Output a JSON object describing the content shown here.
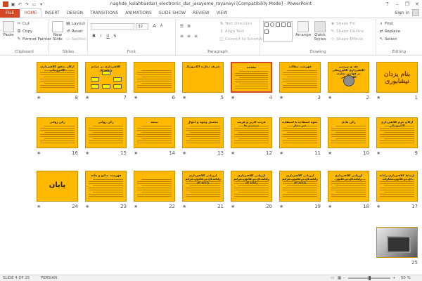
{
  "window": {
    "title": "naghde_kolahbardari_electronic_dar_jarayeme_rayaneyi [Compatibility Mode] - PowerPoint",
    "help": "?",
    "minimize": "–",
    "restore": "❐",
    "close": "✕"
  },
  "qat": {
    "save": "▣",
    "undo": "↶",
    "redo": "↷",
    "start": "▭",
    "more": "▾"
  },
  "tabs": [
    {
      "label": "FILE"
    },
    {
      "label": "HOME"
    },
    {
      "label": "INSERT"
    },
    {
      "label": "DESIGN"
    },
    {
      "label": "TRANSITIONS"
    },
    {
      "label": "ANIMATIONS"
    },
    {
      "label": "SLIDE SHOW"
    },
    {
      "label": "REVIEW"
    },
    {
      "label": "VIEW"
    }
  ],
  "account": {
    "signin": "Sign in"
  },
  "ribbon": {
    "clipboard": {
      "label": "Clipboard",
      "paste": "Paste",
      "cut": "Cut",
      "copy": "Copy",
      "format_painter": "Format Painter"
    },
    "slides": {
      "label": "Slides",
      "new_slide": "New Slide",
      "layout": "Layout",
      "reset": "Reset",
      "section": "Section"
    },
    "font": {
      "label": "Font",
      "font_size": "32",
      "bold": "B",
      "italic": "I",
      "underline": "U",
      "strike": "S",
      "grow": "A",
      "shrink": "A"
    },
    "paragraph": {
      "label": "Paragraph",
      "text_direction": "Text Direction",
      "align_text": "Align Text",
      "convert_smartart": "Convert to SmartArt"
    },
    "drawing": {
      "label": "Drawing",
      "arrange": "Arrange",
      "quick_styles": "Quick Styles",
      "shape_fill": "Shape Fill",
      "shape_outline": "Shape Outline",
      "shape_effects": "Shape Effects"
    },
    "editing": {
      "label": "Editing",
      "find": "Find",
      "replace": "Replace",
      "select": "Select"
    }
  },
  "slides": [
    {
      "num": "1",
      "title": "",
      "fancy": "بنام یزدان نیشابوری",
      "kind": "fancy"
    },
    {
      "num": "2",
      "title": "نقد و بررسی کلاهبرداری الکترونیکی در قوانین تجارت الکترونیکی",
      "kind": "emblem"
    },
    {
      "num": "3",
      "title": "فهرست مطالب",
      "kind": "text"
    },
    {
      "num": "4",
      "title": "مقدمه",
      "kind": "text"
    },
    {
      "num": "5",
      "title": "تعریف تجارت الکترونیک",
      "kind": "title"
    },
    {
      "num": "6",
      "title": "",
      "kind": "text"
    },
    {
      "num": "7",
      "title": "کلاهبرداری در جرایم رایانه ای",
      "kind": "boxes"
    },
    {
      "num": "8",
      "title": "ارکان تحقق کلاهبرداری الکترونیکی",
      "kind": "text"
    },
    {
      "num": "9",
      "title": "ارکان جرم کلاهبرداری الکترونیکی",
      "kind": "text"
    },
    {
      "num": "10",
      "title": "رکن مادی",
      "kind": "text"
    },
    {
      "num": "11",
      "title": "نحوه استفاده با استفاده غیر مجاز",
      "kind": "text"
    },
    {
      "num": "12",
      "title": "فریب کاربر و فریب سیستم ها",
      "kind": "text"
    },
    {
      "num": "13",
      "title": "تحصیل وجوه و اموال",
      "kind": "text"
    },
    {
      "num": "14",
      "title": "نتیجه",
      "kind": "text"
    },
    {
      "num": "15",
      "title": "رکن روانی",
      "kind": "text"
    },
    {
      "num": "16",
      "title": "رکن روانی",
      "kind": "text"
    },
    {
      "num": "17",
      "title": "ارتباط کلاهبرداری رایانه ای در قانون مجازات",
      "kind": "text"
    },
    {
      "num": "18",
      "title": "ارزیابی کلاهبرداری رایانه ای در قانون",
      "kind": "text"
    },
    {
      "num": "19",
      "title": "ارزیابی کلاهبرداری رایانه ای در قانون جرایم رایانه ای",
      "kind": "text"
    },
    {
      "num": "20",
      "title": "ارزیابی کلاهبرداری رایانه ای در قانون جرایم رایانه ای",
      "kind": "text"
    },
    {
      "num": "21",
      "title": "ارزیابی کلاهبرداری رایانه ای در قانون جرایم رایانه ای",
      "kind": "text"
    },
    {
      "num": "22",
      "title": "",
      "kind": "text"
    },
    {
      "num": "23",
      "title": "فهرست منابع و مآخذ",
      "kind": "text"
    },
    {
      "num": "24",
      "title": "",
      "big": "پایان",
      "kind": "big"
    },
    {
      "num": "25",
      "title": "",
      "kind": "photo"
    }
  ],
  "selected_slide": "4",
  "star": "★",
  "status": {
    "slide_info": "SLIDE 4 OF 25",
    "language": "PERSIAN",
    "zoom": "50 %",
    "zoom_minus": "–",
    "zoom_plus": "+",
    "zoom_level": 0.5
  }
}
